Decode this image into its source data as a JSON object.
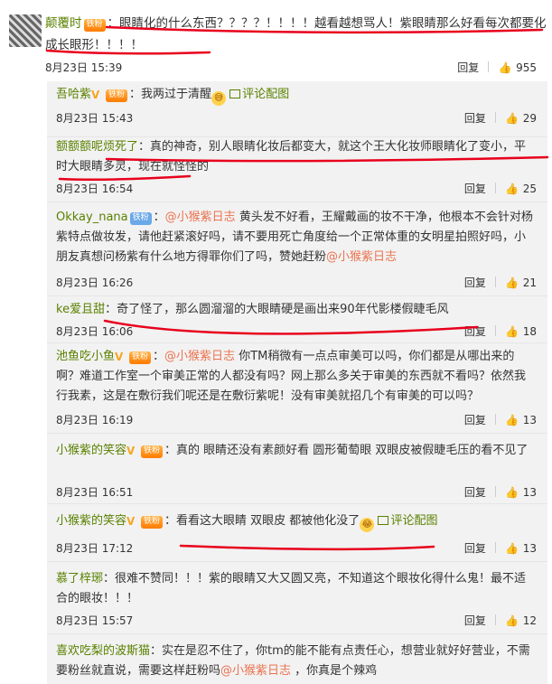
{
  "top_comment": {
    "username": "颠覆时",
    "badge": "铁粉",
    "text": "：眼睛化的什么东西？？？？！！！！越看越想骂人！紫眼睛那么好看每次都要化成长眼形！！！！",
    "time": "8月23日 15:39",
    "reply_label": "回复",
    "likes": "955"
  },
  "replies": [
    {
      "username": "吾哈紫",
      "vip": "V",
      "badge": "铁粉",
      "text_before": "：我两过于清醒",
      "emoji": "😅",
      "img_label": "评论配图",
      "time": "8月23日 15:43",
      "reply_label": "回复",
      "likes": "29"
    },
    {
      "username": "额额额呢烦死了",
      "text_before": "：真的神奇，别人眼睛化妆后都变大，就这个王大化妆师眼睛化了变小，平时大眼睛多灵，现在就怪怪的",
      "time": "8月23日 16:54",
      "reply_label": "回复",
      "likes": "25"
    },
    {
      "username": "Okkay_nana",
      "badge": "铁粉",
      "mention": "@小猴紫日志",
      "text_before": "：",
      "text_after": " 黄头发不好看，王耀戴画的妆不干净，他根本不会针对杨紫特点做妆发，请他赶紧滚好吗，请不要用死亡角度给一个正常体重的女明星拍照好吗，小朋友真想问杨紫有什么地方得罪你们了吗，赞她赶粉",
      "mention2": "@小猴紫日志",
      "time": "8月23日 16:26",
      "reply_label": "回复",
      "likes": "21"
    },
    {
      "username": "ke爱且甜",
      "text_before": "：奇了怪了，那么圆溜溜的大眼睛硬是画出来90年代影楼假睫毛风",
      "time": "8月23日 16:06",
      "reply_label": "回复",
      "likes": "18"
    },
    {
      "username": "池鱼吃小鱼",
      "vip": "V",
      "badge": "铁粉",
      "mention": "@小猴紫日志",
      "text_before": "：",
      "text_after": " 你TM稍微有一点点审美可以吗，你们都是从哪出来的啊？难道工作室一个审美正常的人都没有吗？网上那么多关于审美的东西就不看吗？依然我行我素，这是在敷衍我们呢还是在敷衍紫呢！没有审美就招几个有审美的可以吗？",
      "time": "8月23日 16:19",
      "reply_label": "回复",
      "likes": "13"
    },
    {
      "username": "小猴紫的笑容",
      "vip": "V",
      "badge": "铁粉",
      "text_before": "：真的 眼睛还没有素颜好看 圆形葡萄眼 双眼皮被假睫毛压的看不见了",
      "time": "8月23日 16:51",
      "reply_label": "回复",
      "likes": "13"
    },
    {
      "username": "小猴紫的笑容",
      "vip": "V",
      "badge": "铁粉",
      "text_before": "：看看这大眼睛 双眼皮 都被他化没了",
      "emoji": "😂",
      "img_label": "评论配图",
      "time": "8月23日 17:12",
      "reply_label": "回复",
      "likes": "13"
    },
    {
      "username": "慕了梓琊",
      "text_before": "：很难不赞同！！！紫的眼睛又大又圆又亮，不知道这个眼妆化得什么鬼！最不适合的眼妆！！！",
      "time": "8月23日 15:57",
      "reply_label": "回复",
      "likes": "12"
    },
    {
      "username": "喜欢吃梨的波斯猫",
      "text_before": "：实在是忍不住了，你tm的能不能有点责任心，想营业就好好营业，不需要粉丝就直说，需要这样赶粉吗",
      "mention": "@小猴紫日志",
      "text_after": " ，你真是个辣鸡",
      "time": "",
      "reply_label": "",
      "likes": ""
    }
  ],
  "colors": {
    "username": "#5a8100",
    "mention": "#eb7350",
    "underline": "#e8001c",
    "reply_bg": "#f2f2f2"
  },
  "icons": [
    "thumbs-up-icon",
    "image-icon",
    "emoji-icon",
    "avatar"
  ]
}
